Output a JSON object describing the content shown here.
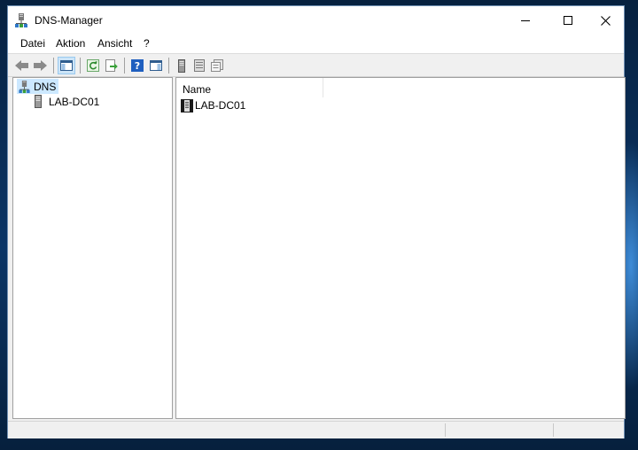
{
  "window": {
    "title": "DNS-Manager",
    "app_icon": "dns-manager-icon"
  },
  "menu": [
    "Datei",
    "Aktion",
    "Ansicht",
    "?"
  ],
  "toolbar": {
    "buttons": [
      "back-icon",
      "forward-icon",
      "show-hide-console-tree-icon",
      "refresh-icon",
      "export-list-icon",
      "help-icon",
      "show-hide-action-pane-icon",
      "server-icon",
      "list-icon",
      "properties-icon"
    ]
  },
  "tree": {
    "root": "DNS",
    "children": [
      "LAB-DC01"
    ]
  },
  "list": {
    "columns": [
      "Name"
    ],
    "items": [
      "LAB-DC01"
    ]
  },
  "colors": {
    "selection": "#cce8ff",
    "window_border": "#6f8fb3",
    "help_icon": "#1f5fbf"
  }
}
